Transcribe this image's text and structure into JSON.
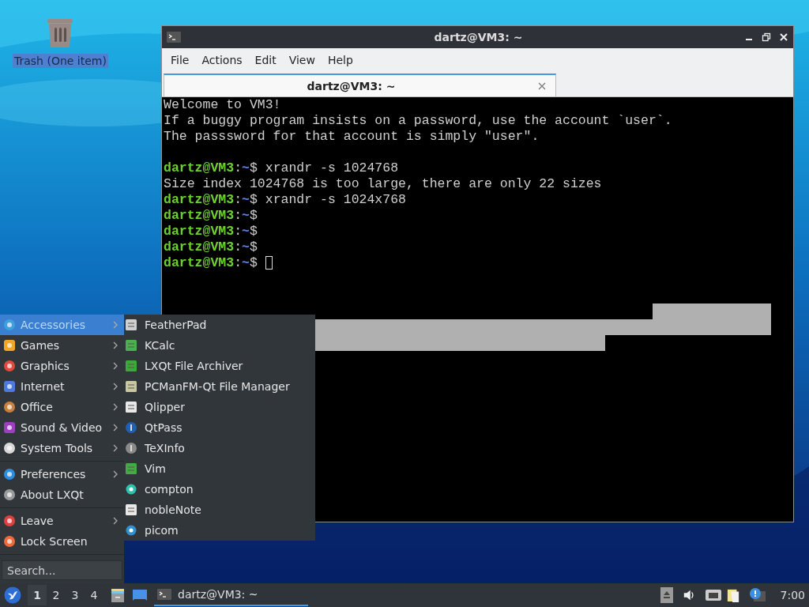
{
  "desktop_icons": [
    {
      "label": "Trash (One item)",
      "selected": true
    }
  ],
  "window": {
    "title": "dartz@VM3: ~",
    "menu": [
      "File",
      "Actions",
      "Edit",
      "View",
      "Help"
    ],
    "tab": {
      "title": "dartz@VM3: ~",
      "selected": true
    },
    "terminal_lines": [
      {
        "kind": "text",
        "text": "Welcome to VM3!"
      },
      {
        "kind": "text",
        "text": "If a buggy program insists on a password, use the account `user`."
      },
      {
        "kind": "text",
        "text": "The passsword for that account is simply \"user\"."
      },
      {
        "kind": "blank"
      },
      {
        "kind": "prompt",
        "user": "dartz@VM3",
        "sep": ":",
        "path": "~",
        "sign": "$",
        "command": "xrandr -s 1024768"
      },
      {
        "kind": "text",
        "text": "Size index 1024768 is too large, there are only 22 sizes"
      },
      {
        "kind": "prompt",
        "user": "dartz@VM3",
        "sep": ":",
        "path": "~",
        "sign": "$",
        "command": "xrandr -s 1024x768"
      },
      {
        "kind": "prompt",
        "user": "dartz@VM3",
        "sep": ":",
        "path": "~",
        "sign": "$"
      },
      {
        "kind": "prompt",
        "user": "dartz@VM3",
        "sep": ":",
        "path": "~",
        "sign": "$"
      },
      {
        "kind": "prompt",
        "user": "dartz@VM3",
        "sep": ":",
        "path": "~",
        "sign": "$"
      },
      {
        "kind": "prompt",
        "user": "dartz@VM3",
        "sep": ":",
        "path": "~",
        "sign": "$",
        "cursor": true
      }
    ]
  },
  "start_menu": {
    "groups": [
      [
        {
          "label": "Accessories",
          "submenu": true,
          "selected": true
        },
        {
          "label": "Games",
          "submenu": true,
          "selected": false
        },
        {
          "label": "Graphics",
          "submenu": true,
          "selected": false
        },
        {
          "label": "Internet",
          "submenu": true,
          "selected": false
        },
        {
          "label": "Office",
          "submenu": true,
          "selected": false
        },
        {
          "label": "Sound & Video",
          "submenu": true,
          "selected": false
        },
        {
          "label": "System Tools",
          "submenu": true,
          "selected": false
        }
      ],
      [
        {
          "label": "Preferences",
          "submenu": true,
          "selected": false
        },
        {
          "label": "About LXQt",
          "submenu": false,
          "selected": false
        }
      ],
      [
        {
          "label": "Leave",
          "submenu": true,
          "selected": false
        },
        {
          "label": "Lock Screen",
          "submenu": false,
          "selected": false
        }
      ]
    ],
    "search": {
      "placeholder": "Search..."
    },
    "submenu": [
      "FeatherPad",
      "KCalc",
      "LXQt File Archiver",
      "PCManFM-Qt File Manager",
      "Qlipper",
      "QtPass",
      "TeXInfo",
      "Vim",
      "compton",
      "nobleNote",
      "picom"
    ]
  },
  "taskbar": {
    "desktops": [
      {
        "label": "1",
        "selected": true
      },
      {
        "label": "2",
        "selected": false
      },
      {
        "label": "3",
        "selected": false
      },
      {
        "label": "4",
        "selected": false
      }
    ],
    "tasks": [
      {
        "title": "dartz@VM3: ~",
        "selected": true
      }
    ],
    "clock": "7:00"
  }
}
